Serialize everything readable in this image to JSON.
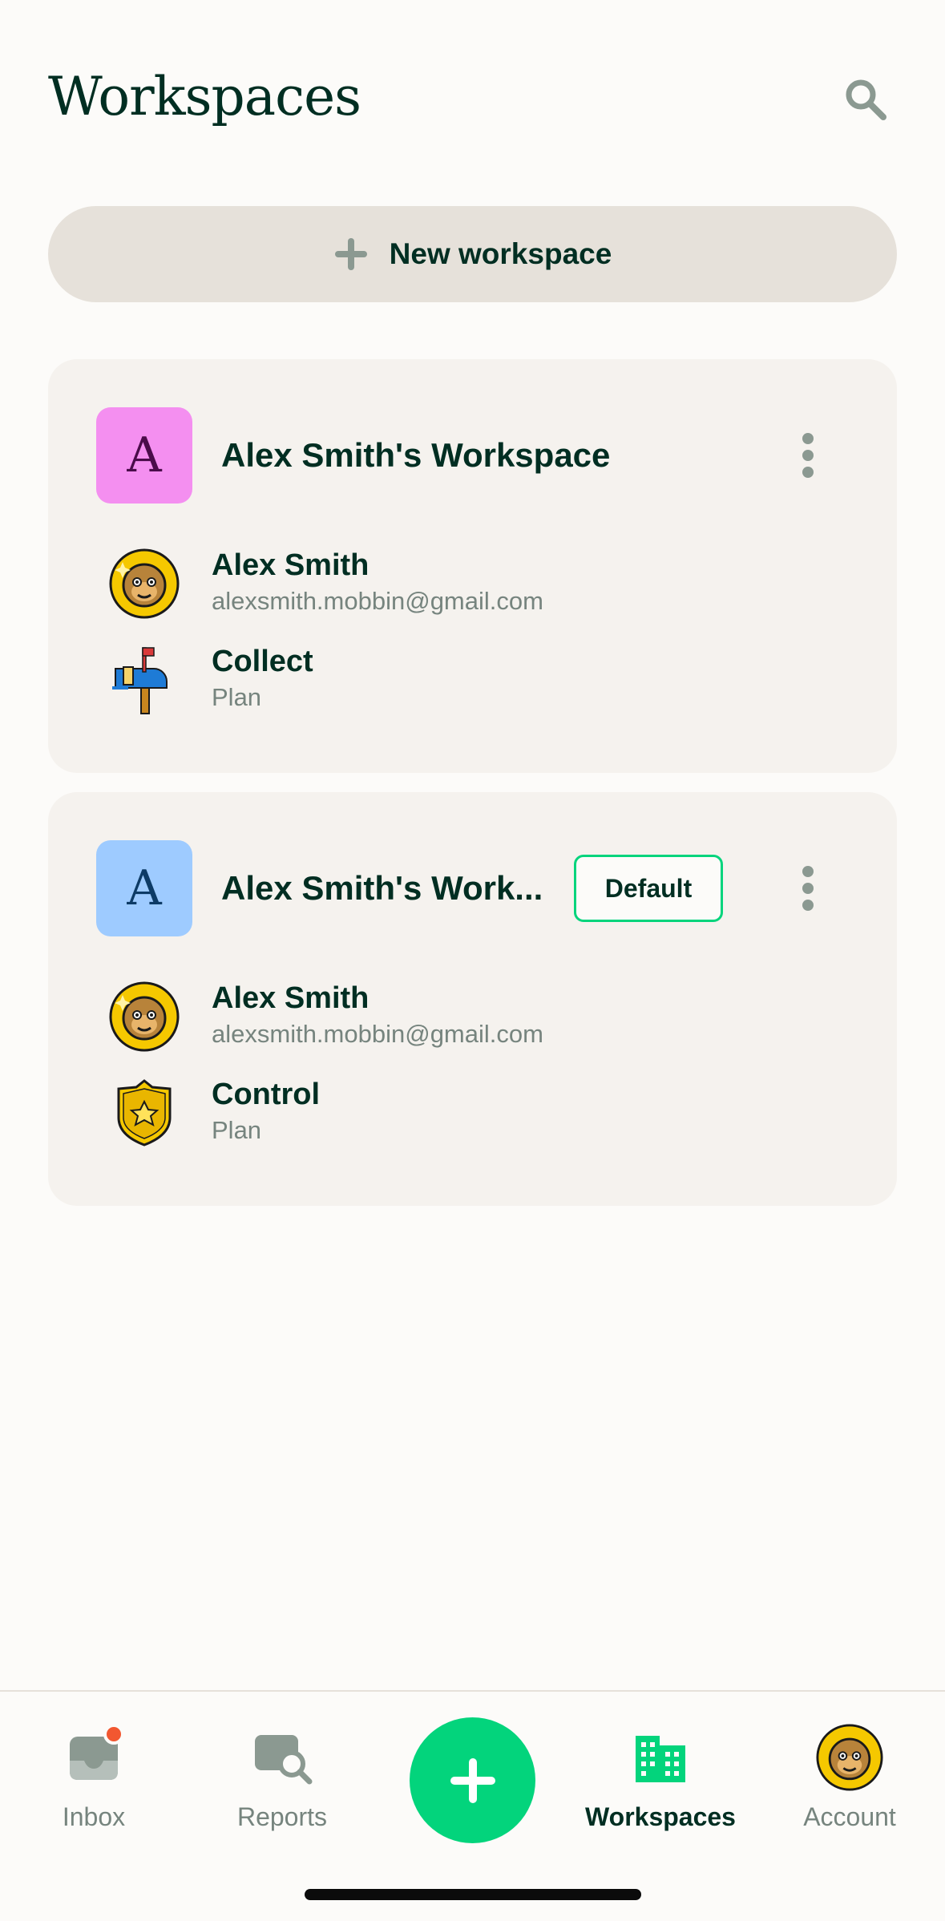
{
  "header": {
    "title": "Workspaces"
  },
  "new_workspace": {
    "label": "New workspace"
  },
  "workspaces": [
    {
      "avatar_letter": "A",
      "avatar_bg": "#F48FF0",
      "avatar_fg": "#4A0C4A",
      "name": "Alex Smith's Workspace",
      "owner": {
        "name": "Alex Smith",
        "email": "alexsmith.mobbin@gmail.com"
      },
      "plan": {
        "name": "Collect",
        "label": "Plan"
      }
    },
    {
      "avatar_letter": "A",
      "avatar_bg": "#9ECBFF",
      "avatar_fg": "#0D3B66",
      "name": "Alex Smith's Work...",
      "badge": "Default",
      "owner": {
        "name": "Alex Smith",
        "email": "alexsmith.mobbin@gmail.com"
      },
      "plan": {
        "name": "Control",
        "label": "Plan"
      }
    }
  ],
  "tabbar": {
    "items": [
      {
        "label": "Inbox",
        "icon": "inbox-icon",
        "has_notification": true
      },
      {
        "label": "Reports",
        "icon": "reports-search-icon"
      },
      {
        "label": "Workspaces",
        "icon": "building-icon",
        "active": true
      },
      {
        "label": "Account",
        "icon": "avatar-icon"
      }
    ],
    "fab_icon": "plus-icon"
  },
  "colors": {
    "accent": "#03D47C",
    "text_primary": "#002E22",
    "text_secondary": "#76847E",
    "card_bg": "#F5F2EE",
    "page_bg": "#FCFBF9",
    "notification": "#F25730"
  }
}
